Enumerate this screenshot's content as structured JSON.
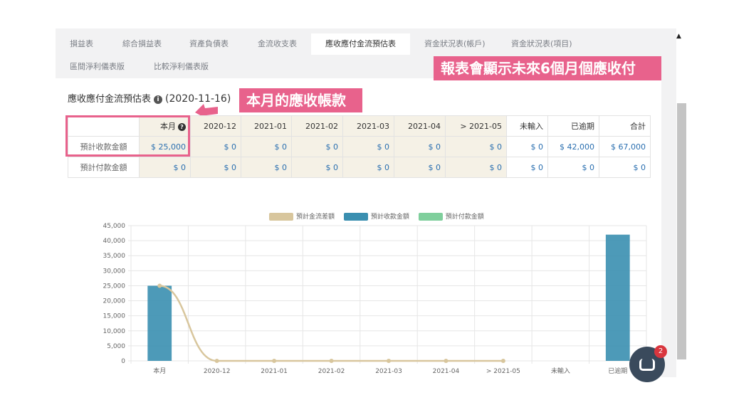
{
  "tabs": [
    {
      "label": "損益表"
    },
    {
      "label": "綜合損益表"
    },
    {
      "label": "資產負債表"
    },
    {
      "label": "金流收支表"
    },
    {
      "label": "應收應付金流預估表"
    },
    {
      "label": "資金狀況表(帳戶)"
    },
    {
      "label": "資金狀況表(項目)"
    },
    {
      "label": "區間淨利儀表版"
    },
    {
      "label": "比較淨利儀表版"
    }
  ],
  "callouts": {
    "top": "報表會顯示未來6個月個應收付",
    "mid": "本月的應收帳款"
  },
  "report": {
    "title": "應收應付金流預估表",
    "date": "(2020-11-16)"
  },
  "table": {
    "headers": [
      "",
      "本月",
      "2020-12",
      "2021-01",
      "2021-02",
      "2021-03",
      "2021-04",
      "> 2021-05",
      "未輸入",
      "已逾期",
      "合計"
    ],
    "rows": [
      {
        "label": "預計收款金額",
        "cells": [
          "$ 25,000",
          "$ 0",
          "$ 0",
          "$ 0",
          "$ 0",
          "$ 0",
          "$ 0",
          "$ 0",
          "$ 42,000",
          "$ 67,000"
        ]
      },
      {
        "label": "預計付款金額",
        "cells": [
          "$ 0",
          "$ 0",
          "$ 0",
          "$ 0",
          "$ 0",
          "$ 0",
          "$ 0",
          "$ 0",
          "$ 0",
          "$ 0"
        ]
      }
    ]
  },
  "chat_badge": "2",
  "colors": {
    "accent": "#e8628c",
    "receive": "#3a8fb0",
    "net": "#d8c69d",
    "pay": "#7fcf9c"
  },
  "chart_data": {
    "type": "bar",
    "categories": [
      "本月",
      "2020-12",
      "2021-01",
      "2021-02",
      "2021-03",
      "2021-04",
      "> 2021-05",
      "未輸入",
      "已逾期"
    ],
    "series": [
      {
        "name": "預計金流差額",
        "type": "line",
        "values": [
          25000,
          0,
          0,
          0,
          0,
          0,
          0,
          null,
          null
        ]
      },
      {
        "name": "預計收款金額",
        "type": "bar",
        "values": [
          25000,
          0,
          0,
          0,
          0,
          0,
          0,
          0,
          42000
        ]
      },
      {
        "name": "預計付款金額",
        "type": "bar",
        "values": [
          0,
          0,
          0,
          0,
          0,
          0,
          0,
          0,
          0
        ]
      }
    ],
    "yticks": [
      "0",
      "5,000",
      "10,000",
      "15,000",
      "20,000",
      "25,000",
      "30,000",
      "35,000",
      "40,000",
      "45,000"
    ],
    "ylim": [
      0,
      45000
    ],
    "grid": true,
    "legend": "top"
  }
}
